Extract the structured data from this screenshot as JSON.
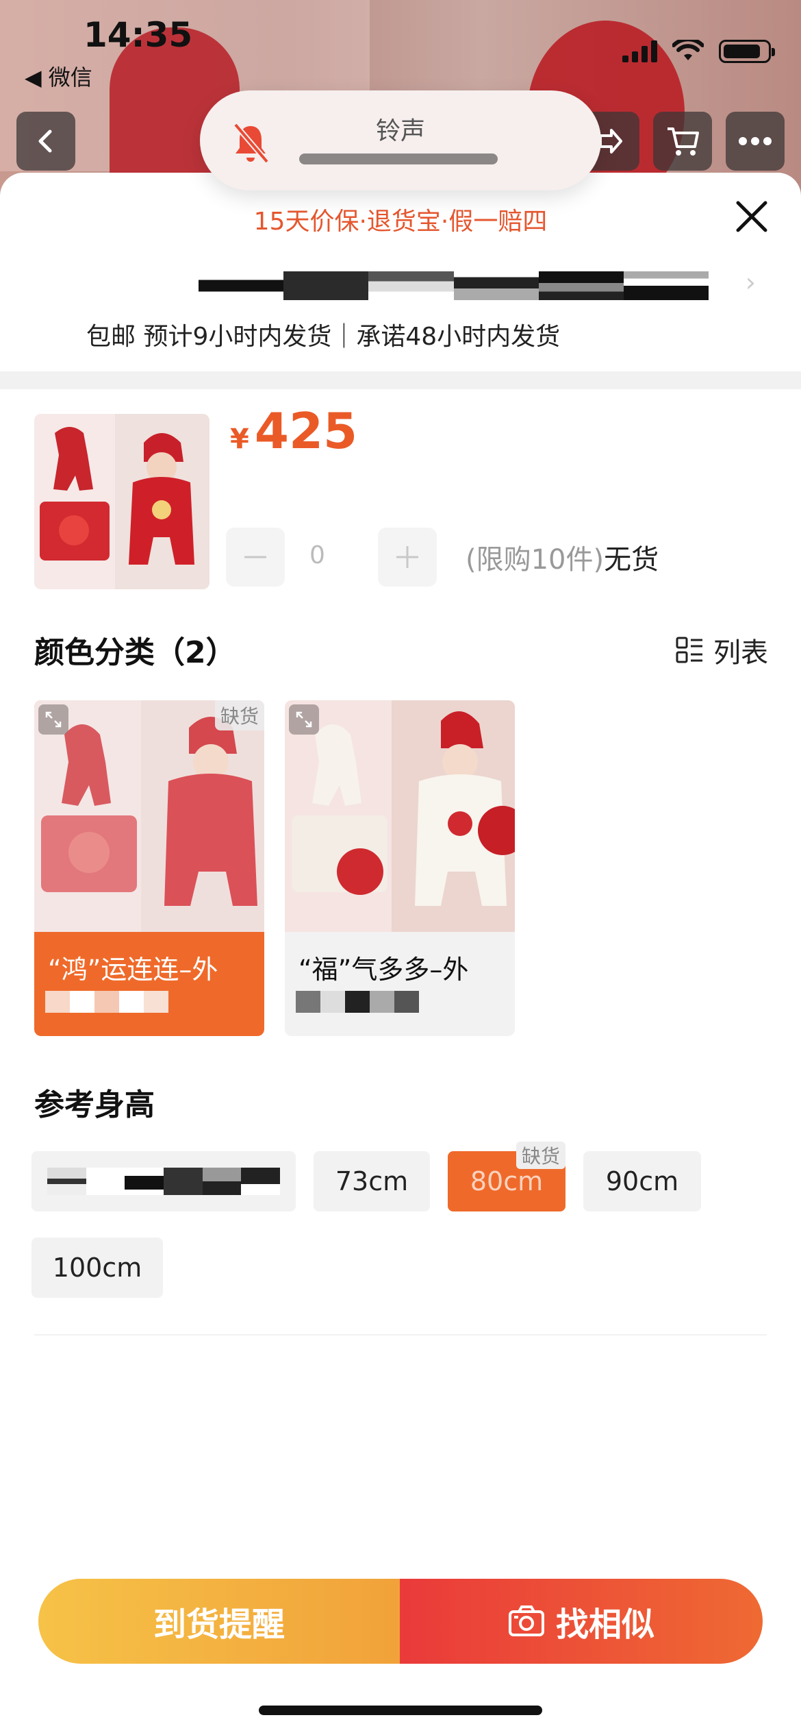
{
  "status_bar": {
    "time": "14:35",
    "back_app": "◀ 微信"
  },
  "notification": {
    "title": "铃声"
  },
  "sheet": {
    "guarantee": "15天价保·退货宝·假一赔四",
    "shipping": "包邮 预计9小时内发货｜承诺48小时内发货"
  },
  "product": {
    "currency": "¥",
    "price": "425",
    "quantity": "0",
    "limit_text": "(限购10件)",
    "stock_status": "无货"
  },
  "color_section": {
    "title": "颜色分类（2）",
    "list_toggle": "列表",
    "options": [
      {
        "label": "“鸿”运连连–外",
        "oos_tag": "缺货"
      },
      {
        "label": "“福”气多多–外"
      }
    ]
  },
  "size_section": {
    "title": "参考身高",
    "sizes": [
      "73cm",
      "80cm",
      "90cm",
      "100cm"
    ],
    "oos_tag": "缺货"
  },
  "actions": {
    "notify": "到货提醒",
    "similar": "找相似"
  },
  "colors": {
    "accent": "#ef6a2a",
    "price": "#ea5a27",
    "guarantee": "#e5572f"
  }
}
